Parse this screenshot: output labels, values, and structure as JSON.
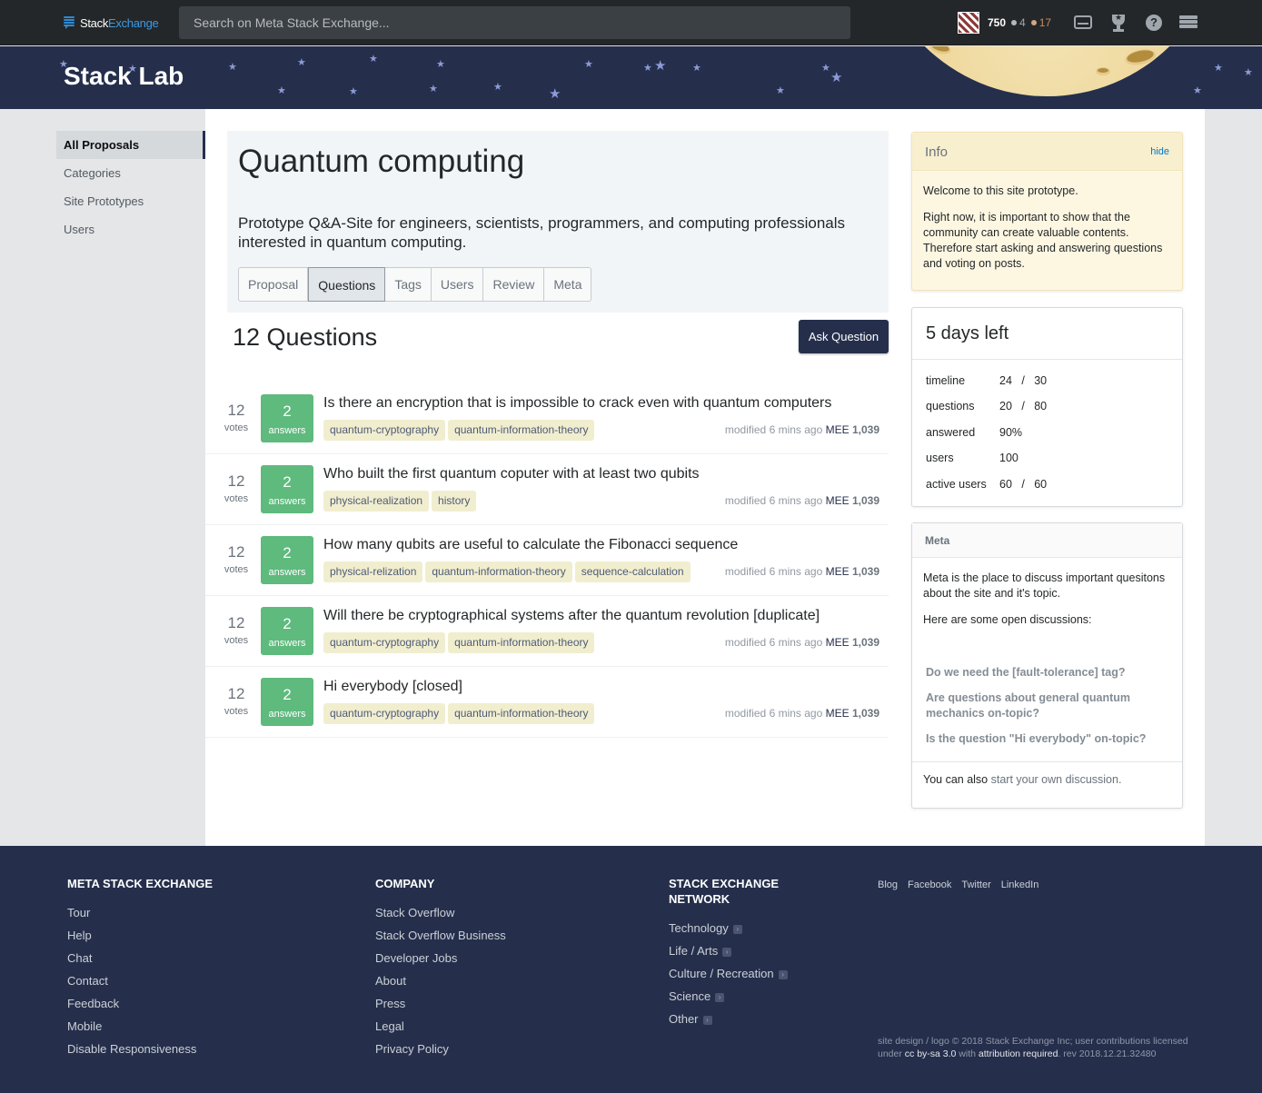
{
  "topbar": {
    "logo_word1": "Stack",
    "logo_word2": "Exchange",
    "search_placeholder": "Search on Meta Stack Exchange...",
    "reputation": "750",
    "silver_badges": "4",
    "bronze_badges": "17",
    "icons": [
      "inbox-icon",
      "trophy-icon",
      "help-icon",
      "stack-exchange-icon"
    ]
  },
  "banner": {
    "site_title": "Stack Lab"
  },
  "leftnav": {
    "items": [
      {
        "label": "All Proposals",
        "active": true
      },
      {
        "label": "Categories"
      },
      {
        "label": "Site Prototypes"
      },
      {
        "label": "Users"
      }
    ]
  },
  "hero": {
    "title": "Quantum computing",
    "description": "Prototype Q&A-Site for engineers, scientists, programmers, and computing professionals interested in quantum computing.",
    "tabs": [
      {
        "label": "Proposal"
      },
      {
        "label": "Questions",
        "active": true
      },
      {
        "label": "Tags"
      },
      {
        "label": "Users"
      },
      {
        "label": "Review"
      },
      {
        "label": "Meta"
      }
    ]
  },
  "questions": {
    "count_label": "12 Questions",
    "ask_button": "Ask Question",
    "votes_label": "votes",
    "answers_label": "answers",
    "modified_label": "modified 6 mins ago",
    "items": [
      {
        "votes": "12",
        "answers": "2",
        "title": "Is there an encryption that is impossible to crack even with quantum computers",
        "tags": [
          "quantum-cryptography",
          "quantum-information-theory"
        ],
        "user": "MEE",
        "rep": "1,039"
      },
      {
        "votes": "12",
        "answers": "2",
        "title": "Who built the first quantum coputer with at least two qubits",
        "tags": [
          "physical-realization",
          "history"
        ],
        "user": "MEE",
        "rep": "1,039"
      },
      {
        "votes": "12",
        "answers": "2",
        "title": "How many qubits are useful to calculate the Fibonacci sequence",
        "tags": [
          "physical-relization",
          "quantum-information-theory",
          "sequence-calculation"
        ],
        "user": "MEE",
        "rep": "1,039"
      },
      {
        "votes": "12",
        "answers": "2",
        "title": "Will there be cryptographical systems after the quantum revolution [duplicate]",
        "tags": [
          "quantum-cryptography",
          "quantum-information-theory"
        ],
        "user": "MEE",
        "rep": "1,039"
      },
      {
        "votes": "12",
        "answers": "2",
        "title": "Hi everybody [closed]",
        "tags": [
          "quantum-cryptography",
          "quantum-information-theory"
        ],
        "user": "MEE",
        "rep": "1,039"
      }
    ]
  },
  "info": {
    "title": "Info",
    "hide_label": "hide",
    "paragraph1": "Welcome to this site prototype.",
    "paragraph2": "Right now, it is important to show that the community can create valuable contents. Therefore start asking and answering questions and voting on posts."
  },
  "stats": {
    "title": "5 days left",
    "rows": [
      {
        "label": "timeline",
        "value": "24   /   30"
      },
      {
        "label": "questions",
        "value": "20   /   80"
      },
      {
        "label": "answered",
        "value": "90%"
      },
      {
        "label": "users",
        "value": "100"
      },
      {
        "label": "active users",
        "value": "60   /   60"
      }
    ]
  },
  "meta": {
    "title": "Meta",
    "intro": "Meta is the place to discuss important quesitons about the site and it's topic.",
    "open_label": "Here are some open discussions:",
    "discussions": [
      "Do we need the [fault-tolerance] tag?",
      "Are questions about general quantum mechanics on-topic?",
      "Is the question \"Hi everybody\" on-topic?"
    ],
    "footer_prefix": "You can also ",
    "footer_link": "start your own discussion."
  },
  "footer": {
    "col1": {
      "title": "Meta Stack Exchange",
      "links": [
        "Tour",
        "Help",
        "Chat",
        "Contact",
        "Feedback",
        "Mobile",
        "Disable Responsiveness"
      ]
    },
    "col2": {
      "title": "Company",
      "links": [
        "Stack Overflow",
        "Stack Overflow Business",
        "Developer Jobs",
        "About",
        "Press",
        "Legal",
        "Privacy Policy"
      ]
    },
    "col3": {
      "title": "Stack Exchange Network",
      "links": [
        "Technology",
        "Life / Arts",
        "Culture / Recreation",
        "Science",
        "Other"
      ]
    },
    "social": [
      "Blog",
      "Facebook",
      "Twitter",
      "LinkedIn"
    ],
    "copyright_1": "site design / logo © 2018 Stack Exchange Inc; user contributions licensed under ",
    "license": "cc by-sa 3.0",
    "with": " with ",
    "attribution": "attribution required",
    "rev": ". rev 2018.12.21.32480"
  },
  "colors": {
    "brand_navy": "#252f4c",
    "answered_green": "#5eba7d",
    "tag_bg": "#f1eecf",
    "topbar": "#242729",
    "info_bg": "#fdf7e2"
  }
}
